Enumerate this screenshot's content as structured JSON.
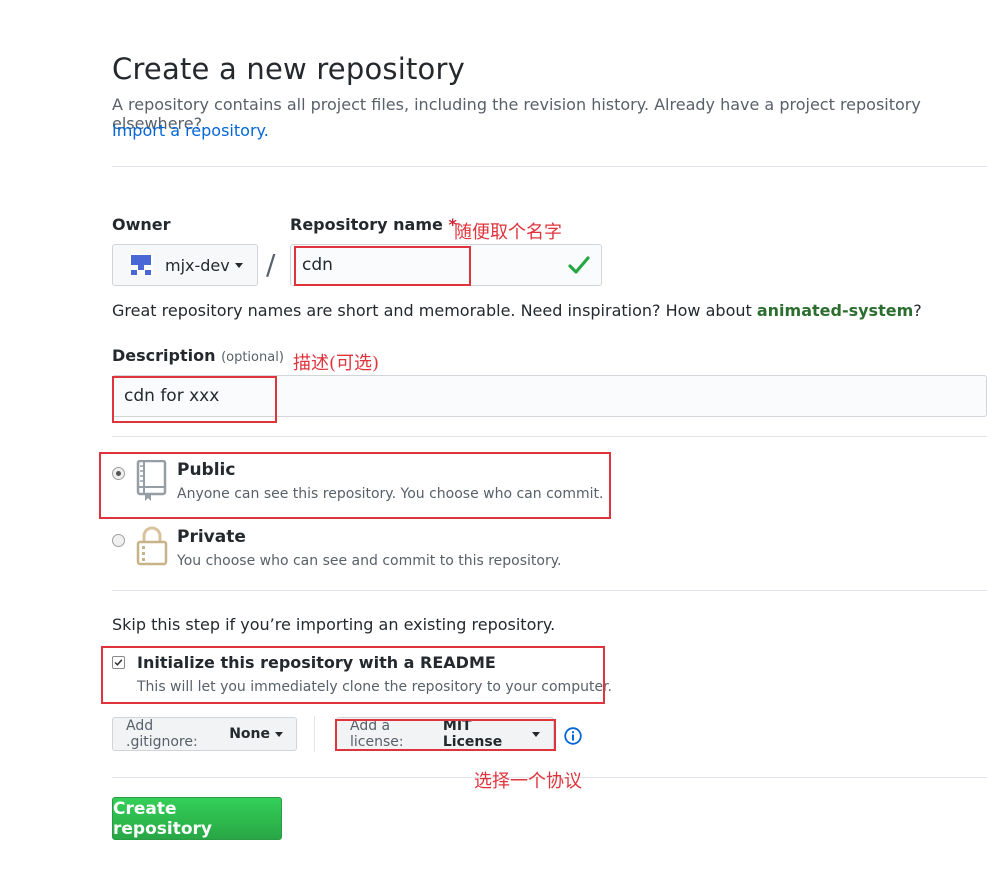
{
  "header": {
    "title": "Create a new repository",
    "subtitle": "A repository contains all project files, including the revision history. Already have a project repository elsewhere?",
    "import_link": "Import a repository."
  },
  "owner": {
    "label": "Owner",
    "value": "mjx-dev",
    "separator": "/"
  },
  "repo_name": {
    "label": "Repository name",
    "required_mark": "*",
    "value": "cdn",
    "annotation": "随便取个名字"
  },
  "hint": {
    "prefix": "Great repository names are short and memorable. Need inspiration? How about ",
    "suggestion": "animated-system",
    "suffix": "?"
  },
  "description": {
    "label": "Description",
    "optional": "(optional)",
    "value": "cdn for xxx",
    "annotation": "描述(可选)"
  },
  "visibility": {
    "public": {
      "title": "Public",
      "note": "Anyone can see this repository. You choose who can commit.",
      "selected": true
    },
    "private": {
      "title": "Private",
      "note": "You choose who can see and commit to this repository.",
      "selected": false
    }
  },
  "init": {
    "skip_text": "Skip this step if you’re importing an existing repository.",
    "readme_title": "Initialize this repository with a README",
    "readme_note": "This will let you immediately clone the repository to your computer.",
    "readme_checked": true
  },
  "gitignore": {
    "prefix": "Add .gitignore:",
    "value": "None"
  },
  "license": {
    "prefix": "Add a license:",
    "value": "MIT License",
    "annotation": "选择一个协议"
  },
  "submit": {
    "label": "Create repository"
  },
  "colors": {
    "annotation_red": "#e0343c",
    "accent_blue": "#0366d6",
    "submit_green": "#28a745",
    "suggestion_green": "#2c6e2f"
  }
}
